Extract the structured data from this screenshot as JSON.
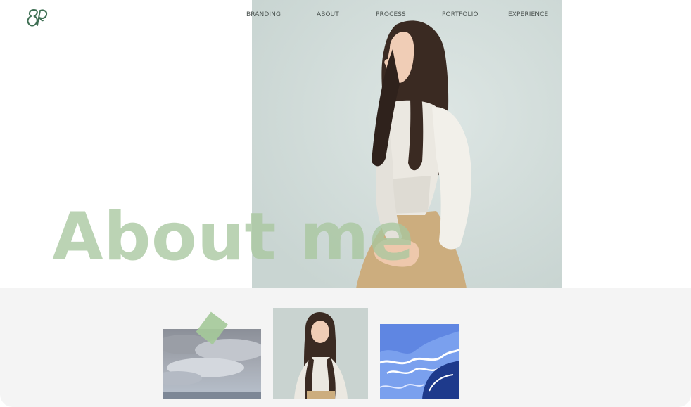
{
  "nav": {
    "items": [
      {
        "label": "BRANDING"
      },
      {
        "label": "ABOUT"
      },
      {
        "label": "PROCESS"
      },
      {
        "label": "PORTFOLIO"
      },
      {
        "label": "EXPERIENCE"
      }
    ]
  },
  "hero": {
    "headline": "About me"
  },
  "icons": {
    "logo": "monogram-logo-icon"
  },
  "colors": {
    "accent_green": "#a9c79f",
    "brand_dark_green": "#3d6e52",
    "photo_backdrop": "#d1dcda",
    "gallery_background": "#f4f4f4",
    "tape_green": "#a5c99a",
    "art_blue": "#5d83e0"
  }
}
